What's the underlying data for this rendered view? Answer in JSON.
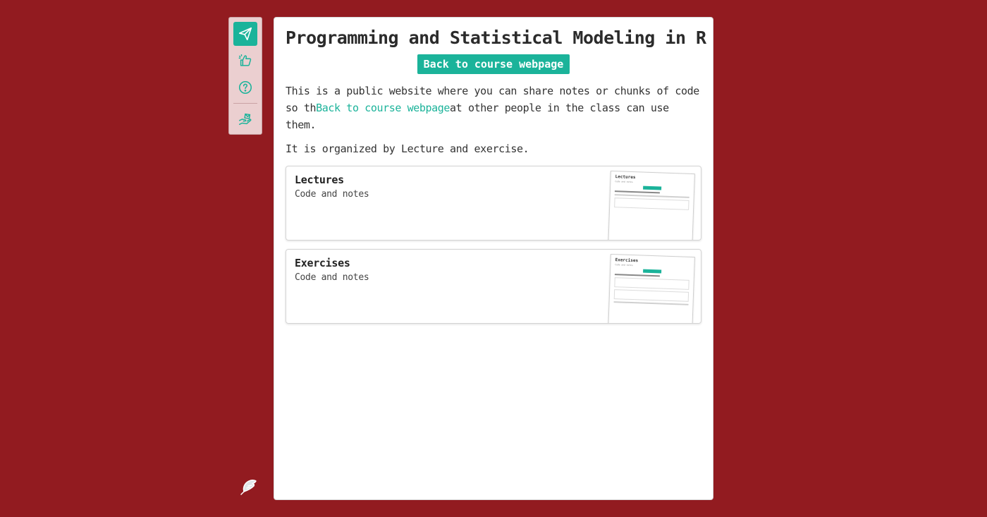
{
  "toolbar": {
    "items": [
      {
        "icon": "paper-plane-icon",
        "active": true
      },
      {
        "icon": "thumbs-up-sparkle-icon",
        "active": false
      },
      {
        "icon": "question-circle-icon",
        "active": false
      },
      {
        "icon": "hand-share-icon",
        "active": false
      }
    ]
  },
  "footer_icon": "feather-icon",
  "page": {
    "title": "Programming and Statistical Modeling in R",
    "back_button": "Back to course webpage",
    "intro_before": "This is a public website where you can share notes or chunks of code so th",
    "intro_link": "Back to course webpage",
    "intro_after": "at other people in the class can use them.",
    "organized": "It is organized by Lecture and exercise."
  },
  "entries": [
    {
      "title": "Lectures",
      "subtitle": "Code and notes"
    },
    {
      "title": "Exercises",
      "subtitle": "Code and notes"
    }
  ],
  "colors": {
    "background": "#921b20",
    "accent": "#1bb39a",
    "toolbar": "#ebcfd0"
  }
}
